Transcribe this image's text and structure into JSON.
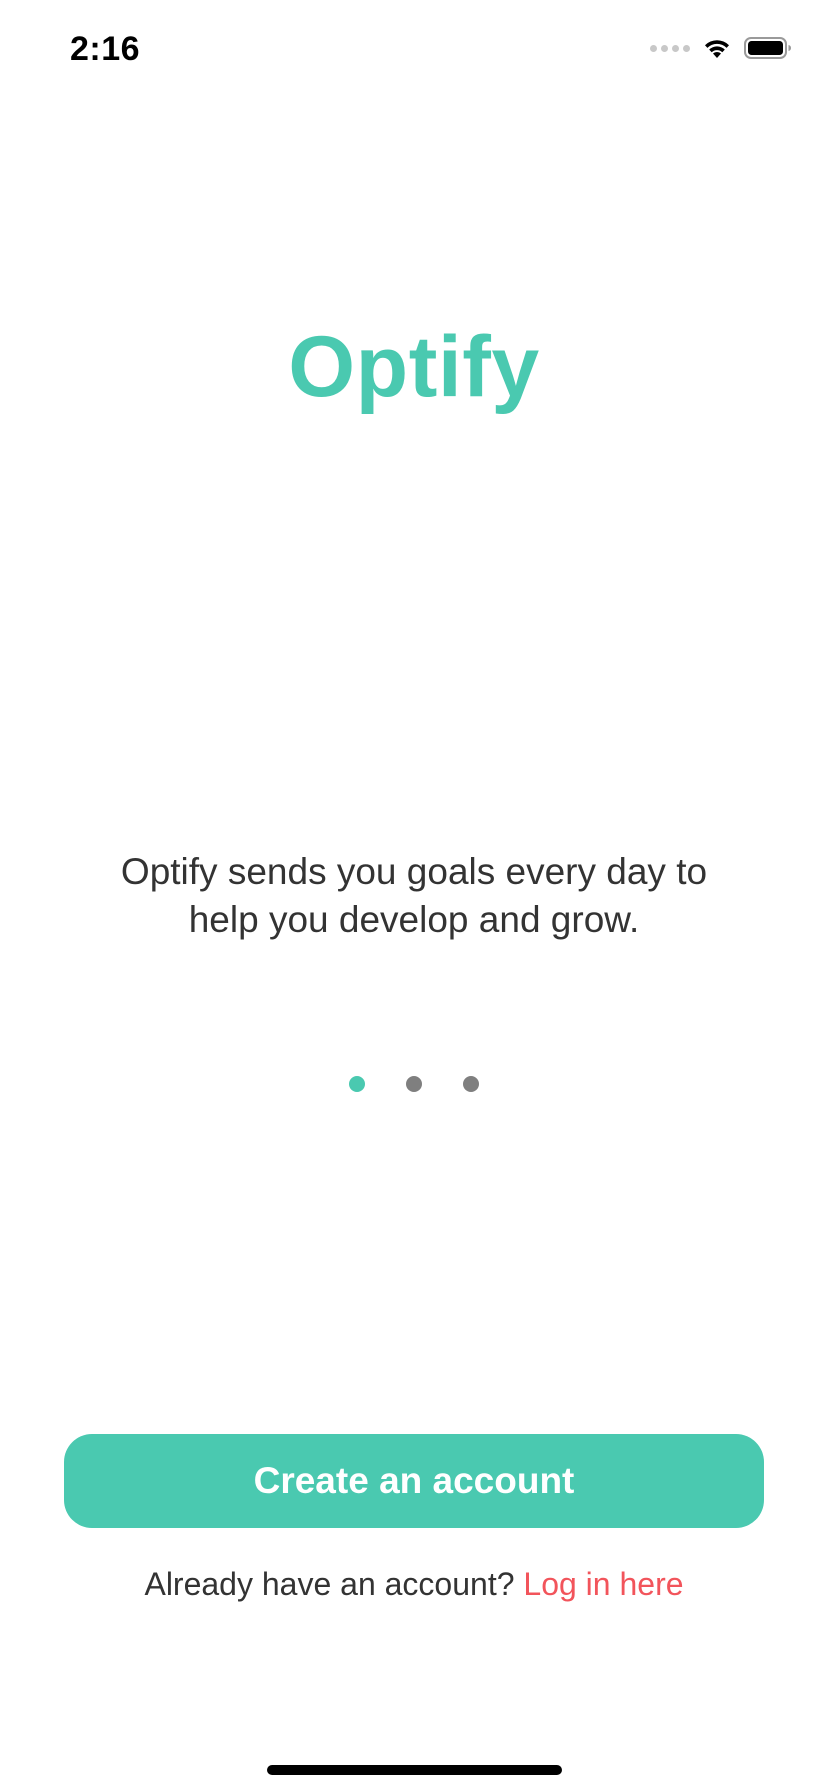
{
  "status_bar": {
    "time": "2:16",
    "icons": [
      "cellular-signal-icon",
      "wifi-icon",
      "battery-icon"
    ]
  },
  "app": {
    "title": "Optify",
    "tagline": "Optify sends you goals every day to help you develop and grow."
  },
  "pager": {
    "total_pages": 3,
    "current_page": 1
  },
  "actions": {
    "create_account_label": "Create an account",
    "login_prompt": "Already have an account?",
    "login_link": "Log in here"
  },
  "colors": {
    "accent": "#4ac9b0",
    "link": "#f2545b",
    "text": "#333333",
    "inactive_dot": "#7f7f7f"
  }
}
